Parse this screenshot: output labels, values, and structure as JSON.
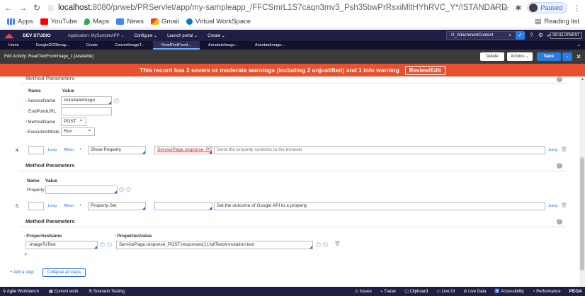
{
  "browser": {
    "url_host": "localhost",
    "url_rest": ":8080/prweb/PRServlet/app/my-sampleapp_/FFCSmrL1S7caqn3mv3_Psh35bwPrRsxiMltHYhRVC_Y*/!STANDARD",
    "paused_label": "Paused",
    "bookmarks": [
      "Apps",
      "YouTube",
      "Maps",
      "News",
      "Gmail",
      "Virtual WorkSpace"
    ],
    "reading_list": "Reading list"
  },
  "studio": {
    "name": "DEV STUDIO",
    "menu": [
      "Application: MySampleAPP ⌄",
      "Configure ⌄",
      "Launch portal ⌄",
      "Create ⌄"
    ],
    "search_value": "O_AttachmentContent",
    "dev_badge": "DEVELOPMENT"
  },
  "tabs": [
    "Home",
    "GoogleOCRImag...",
    "Create",
    "ConvertImageT...",
    "ReadTextFromI...",
    "AnnotateImage...",
    "AnnotateImage..."
  ],
  "active_tab": 4,
  "rule": {
    "title": "Edit  Activity: ReadTextFromImage_1 [Available]",
    "delete": "Delete",
    "actions": "Actions ⌄",
    "save": "Save"
  },
  "warning": {
    "text": "This record has 2 severe or moderate warnings (including 2 unjustified) and 1 info warning",
    "review": "Review/Edit"
  },
  "step3": {
    "section_title": "Method Parameters",
    "col_name": "Name",
    "col_value": "Value",
    "rows": [
      {
        "name": "ServiceName",
        "value": "AnnotateImage"
      },
      {
        "name": "EndPointURL",
        "value": ""
      },
      {
        "name": "MethodName",
        "value": "POST"
      },
      {
        "name": "ExecutionMode",
        "value": "Run"
      }
    ]
  },
  "step4": {
    "number": "4.",
    "loop": "Loop",
    "when": "When",
    "method": "Show-Property",
    "step_page": "ServicePage.response_POST",
    "description": "Send the property contents to the browser",
    "jump": "Jump",
    "section_title": "Method Parameters",
    "col_name": "Name",
    "col_value": "Value",
    "param_name": "Property"
  },
  "step5": {
    "number": "5.",
    "loop": "Loop",
    "when": "When",
    "method": "Property-Set",
    "step_page": "",
    "description": "Set the outcome of Google API to a property",
    "jump": "Jump",
    "section_title": "Method Parameters",
    "col_props_name": "PropertiesName",
    "col_props_value": "PropertiesValue",
    "prop_name": ".ImageToText",
    "prop_value": "ServicePage.response_POST.responses(1).fullTextAnnotation.text"
  },
  "actions": {
    "add_step": "+ Add a step",
    "collapse": "Collapse all steps"
  },
  "footer": {
    "left": [
      "Agile Workbench",
      "Current work",
      "Scenario Testing"
    ],
    "right": [
      "Issues",
      "Tracer",
      "Clipboard",
      "Live UI",
      "Live Data",
      "Accessibility",
      "Performance",
      "PEGA"
    ]
  }
}
